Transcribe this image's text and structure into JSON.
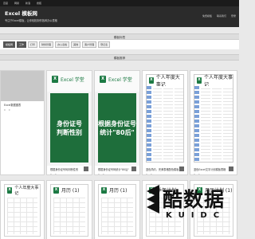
{
  "topnav": [
    "百度",
    "网易",
    "新浪",
    "搜狐"
  ],
  "header": {
    "logo": "Excel 模板网",
    "tagline": "专注于Excel模板，让你轻松制作各种办公表格",
    "right_links": [
      "免费模板",
      "联系我们",
      "登录"
    ]
  },
  "tags_section": {
    "title": "模板标签",
    "tags": [
      "模板网",
      "工作",
      "打印",
      "财务管理",
      "办公表格",
      "其他",
      "客户管理",
      "登记表"
    ]
  },
  "templates_section": {
    "title": "模板推荐"
  },
  "cards": [
    {
      "name": "Excel数据图表",
      "views": "0",
      "downloads": "0",
      "style": "gray"
    },
    {
      "name": "根据身份证号码判断性别",
      "views": "0",
      "downloads": "0",
      "style": "green",
      "excel_title": "Excel 学堂",
      "big_text": [
        "身份证号",
        "判断性别"
      ]
    },
    {
      "name": "根据身份证号码统计\"80后\"",
      "views": "0",
      "downloads": "0",
      "style": "green",
      "excel_title": "Excel 学堂",
      "big_text": [
        "根据身份证号",
        "统计\"80后\""
      ]
    },
    {
      "name": "蓝色简约、完美表格配色模板",
      "views": "0",
      "downloads": "0",
      "style": "cal",
      "cal_title": "个人年度大事记"
    },
    {
      "name": "蓝色Excel文字计划模板表格",
      "views": "0",
      "downloads": "0",
      "style": "cal",
      "cal_title": "个人年度大事记"
    }
  ],
  "row2": [
    {
      "title": "个人年度大事记"
    },
    {
      "title": "月历 (1)"
    },
    {
      "title": "月历 (1)"
    },
    {
      "title": "季年计划"
    },
    {
      "title": "月历计划 (1)"
    }
  ],
  "watermark": {
    "main": "酷数据",
    "sub": "KUIDC"
  }
}
